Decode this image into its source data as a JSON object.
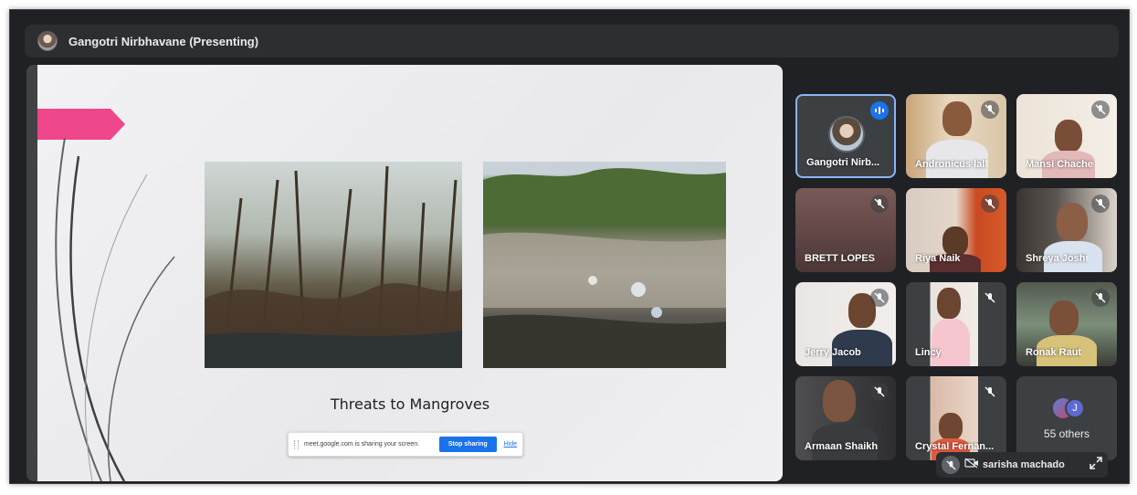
{
  "presenting_bar": {
    "title": "Gangotri Nirbhavane (Presenting)"
  },
  "slide": {
    "caption": "Threats to Mangroves",
    "accent_color": "#f0468c"
  },
  "share_bar": {
    "message": "meet.google.com is sharing your screen.",
    "stop_label": "Stop sharing",
    "hide_label": "Hide"
  },
  "participants": [
    {
      "name": "Gangotri Nirb...",
      "speaking": true
    },
    {
      "name": "Andronicus lall",
      "muted": true
    },
    {
      "name": "Mansi Chache",
      "muted": true
    },
    {
      "name": "BRETT LOPES",
      "muted": true
    },
    {
      "name": "Riya Naik",
      "muted": true
    },
    {
      "name": "Shreya Joshi",
      "muted": true
    },
    {
      "name": "Jerry Jacob",
      "muted": true
    },
    {
      "name": "Lincy",
      "muted": true
    },
    {
      "name": "Ronak Raut",
      "muted": true
    },
    {
      "name": "Armaan Shaikh",
      "muted": true
    },
    {
      "name": "Crystal Fernan...",
      "muted": true
    }
  ],
  "others": {
    "label": "55 others",
    "avatar_initial": "J"
  },
  "self_view": {
    "name": "sarisha machado"
  },
  "colors": {
    "background": "#202124",
    "tile": "#3c4043",
    "active_border": "#8ab4f8",
    "accent_blue": "#1a73e8"
  }
}
